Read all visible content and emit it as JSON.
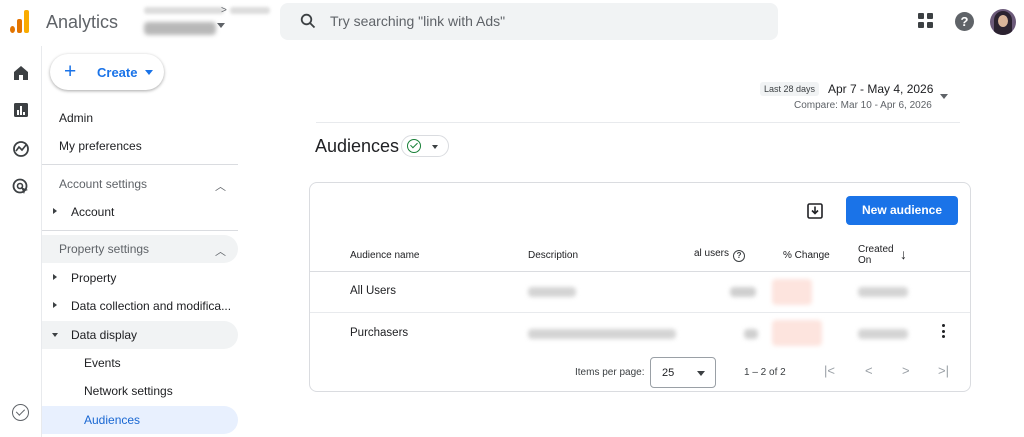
{
  "header": {
    "app_title": "Analytics",
    "account_separator": ">",
    "search_placeholder": "Try searching \"link with Ads\""
  },
  "create_button": {
    "label": "Create"
  },
  "sidenav": {
    "admin": "Admin",
    "my_preferences": "My preferences",
    "account_settings": "Account settings",
    "account": "Account",
    "property_settings": "Property settings",
    "property": "Property",
    "data_collection": "Data collection and modifica...",
    "data_display": "Data display",
    "events": "Events",
    "network_settings": "Network settings",
    "audiences": "Audiences"
  },
  "date_range": {
    "preset": "Last 28 days",
    "range": "Apr 7 - May 4, 2026",
    "compare": "Compare: Mar 10 - Apr 6, 2026"
  },
  "page": {
    "title": "Audiences"
  },
  "table": {
    "new_audience_label": "New audience",
    "columns": {
      "name": "Audience name",
      "description": "Description",
      "users": "al users",
      "change": "% Change",
      "created_1": "Created",
      "created_2": "On"
    },
    "rows": [
      {
        "name": "All Users"
      },
      {
        "name": "Purchasers"
      }
    ],
    "items_per_page_label": "Items per page:",
    "items_per_page_value": "25",
    "range_label": "1 – 2 of 2"
  },
  "colors": {
    "accent": "#1a73e8",
    "logo_orange": "#e37400",
    "logo_yellow": "#f9ab00"
  }
}
